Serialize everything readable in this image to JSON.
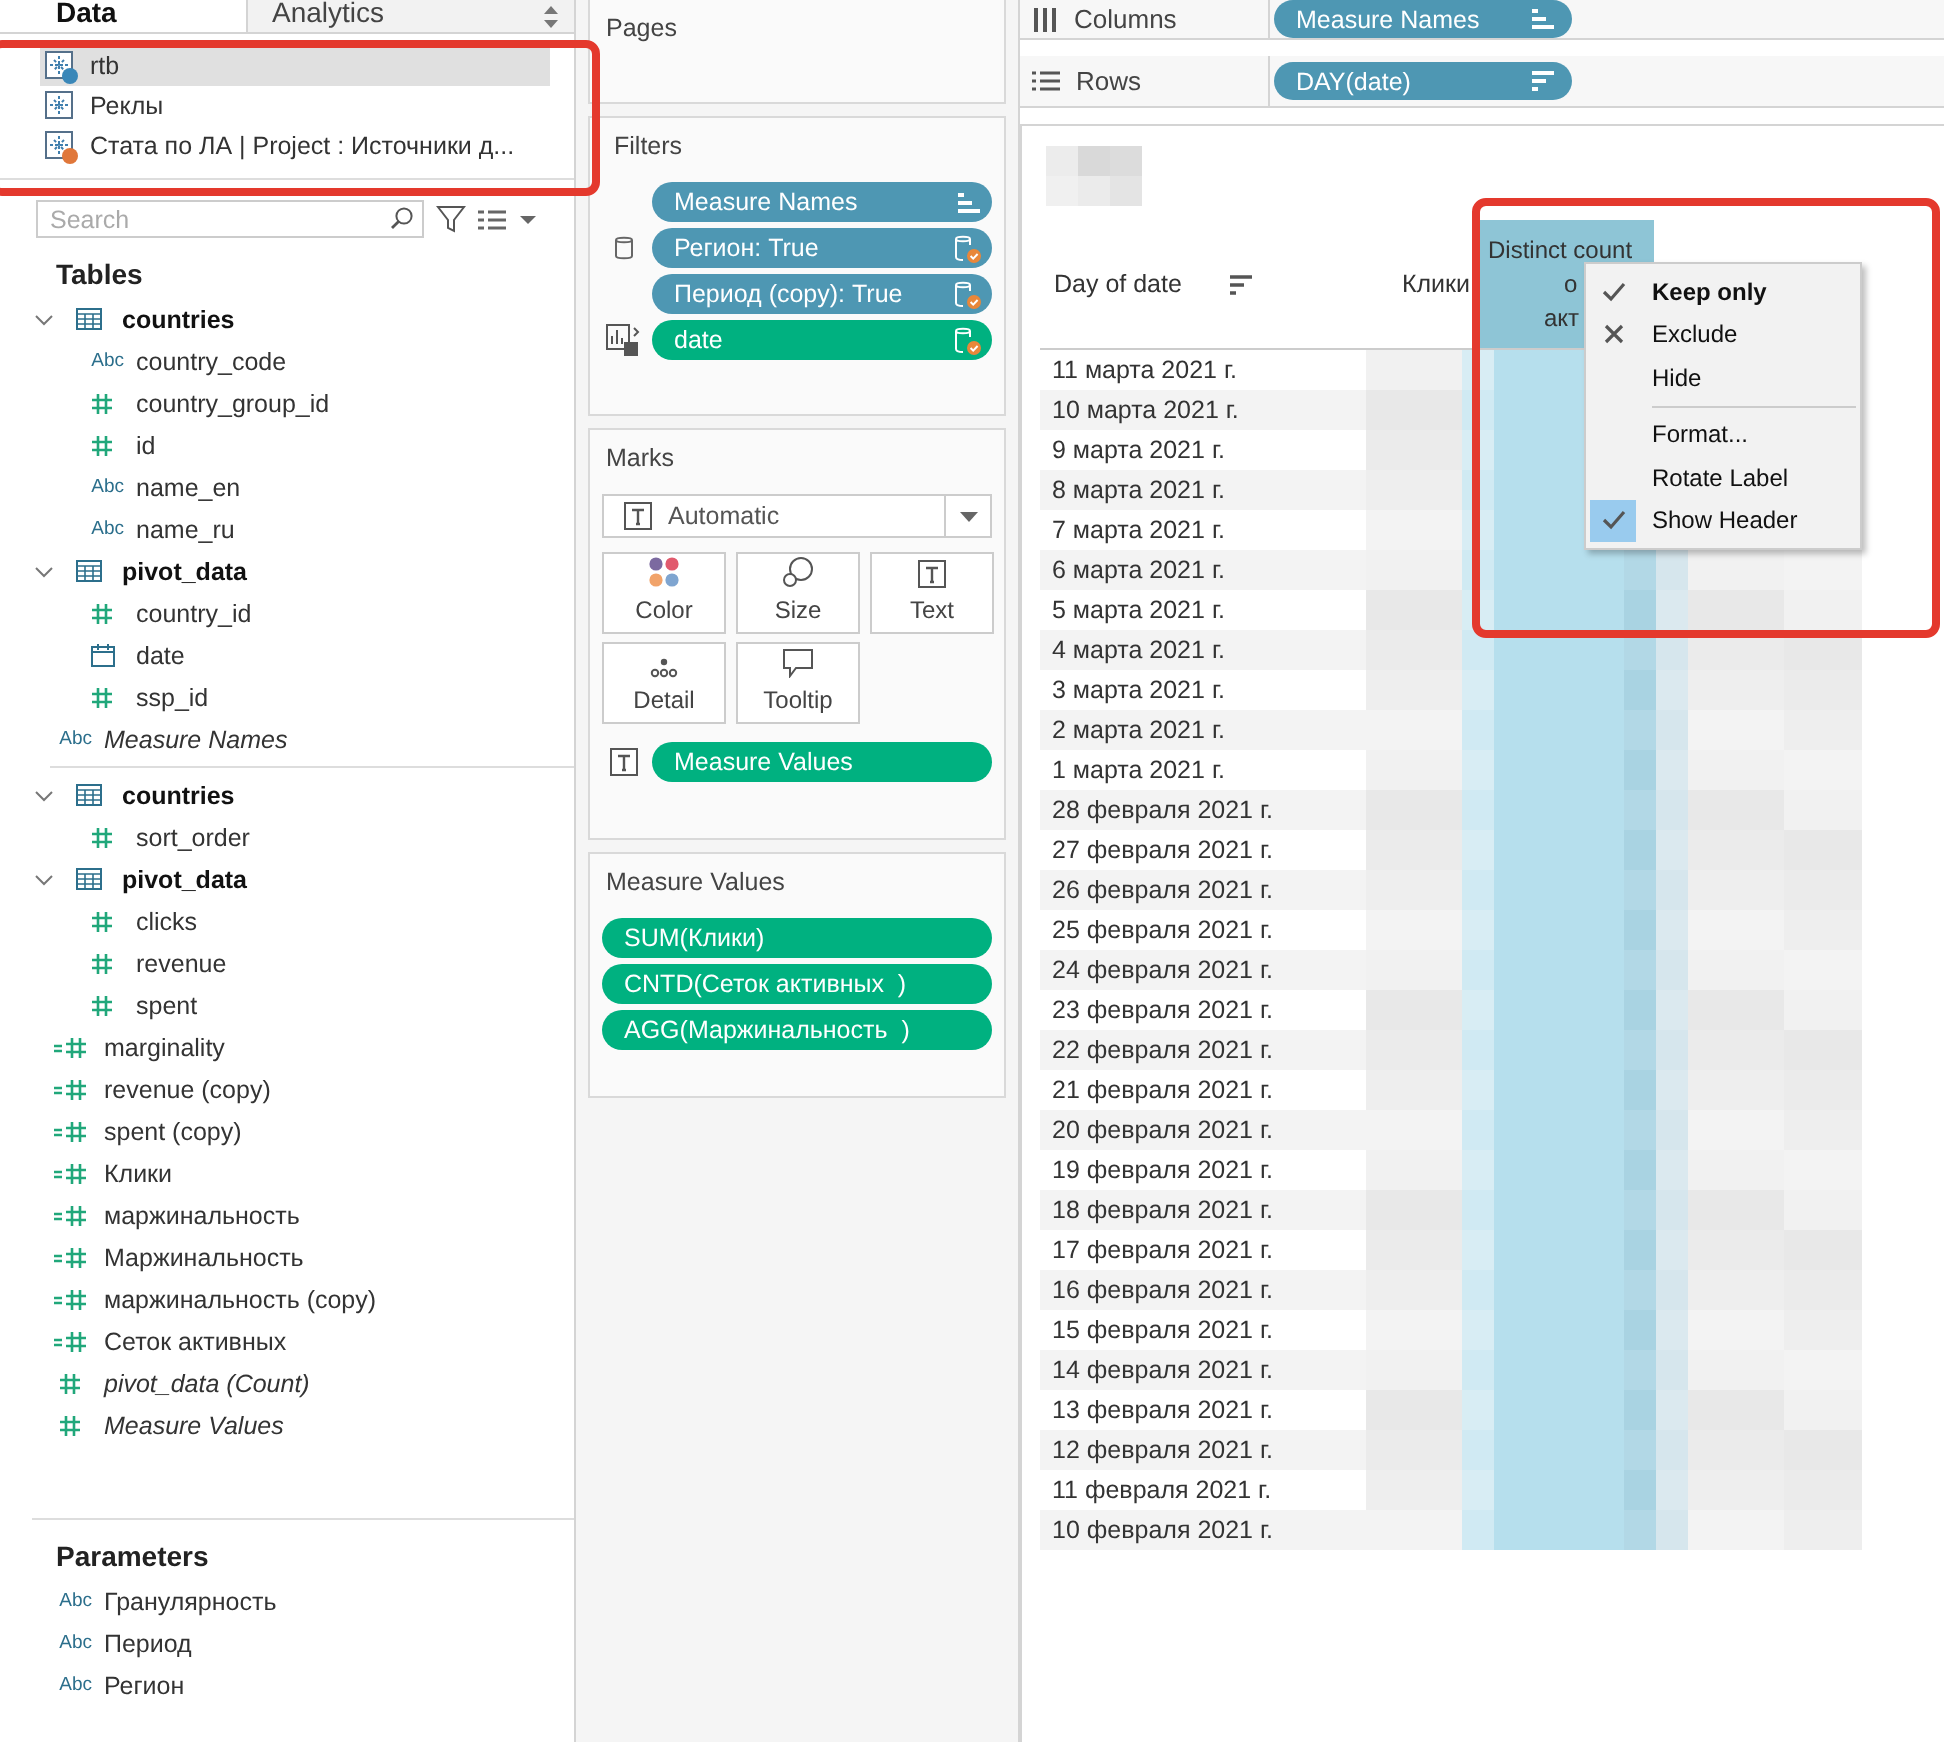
{
  "data_pane": {
    "tabs": [
      {
        "label": "Data",
        "selected": true
      },
      {
        "label": "Analytics",
        "selected": false
      }
    ],
    "data_sources": [
      {
        "name": "rtb",
        "selected": true,
        "color": "#3a87b8"
      },
      {
        "name": "Реклы",
        "selected": false
      },
      {
        "name": "Стата по ЛА | Project : Источники д...",
        "selected": false,
        "color": "#e0773a"
      }
    ],
    "search": {
      "placeholder": "Search"
    },
    "tables_heading": "Tables",
    "field_sections": [
      [
        {
          "kind": "table",
          "name": "countries",
          "expanded": true,
          "children": [
            {
              "name": "country_code",
              "kind": "string",
              "glyph": "Abc"
            },
            {
              "name": "country_group_id",
              "kind": "number"
            },
            {
              "name": "id",
              "kind": "number"
            },
            {
              "name": "name_en",
              "kind": "string",
              "glyph": "Abc"
            },
            {
              "name": "name_ru",
              "kind": "string",
              "glyph": "Abc"
            }
          ]
        },
        {
          "kind": "table",
          "name": "pivot_data",
          "expanded": true,
          "children": [
            {
              "name": "country_id",
              "kind": "number"
            },
            {
              "name": "date",
              "kind": "date"
            },
            {
              "name": "ssp_id",
              "kind": "number"
            }
          ]
        },
        {
          "kind": "string",
          "name": "Measure Names",
          "glyph": "Abc",
          "italic": true
        }
      ],
      [
        {
          "kind": "table",
          "name": "countries",
          "expanded": true,
          "children": [
            {
              "name": "sort_order",
              "kind": "number"
            }
          ]
        },
        {
          "kind": "table",
          "name": "pivot_data",
          "expanded": true,
          "children": [
            {
              "name": "clicks",
              "kind": "number"
            },
            {
              "name": "revenue",
              "kind": "number"
            },
            {
              "name": "spent",
              "kind": "number"
            }
          ]
        },
        {
          "kind": "calc",
          "name": "marginality",
          "italic": false
        },
        {
          "kind": "calc",
          "name": "revenue (copy)",
          "italic": false
        },
        {
          "kind": "calc",
          "name": "spent (copy)",
          "italic": false
        },
        {
          "kind": "calc",
          "name": "Клики",
          "italic": false
        },
        {
          "kind": "calc",
          "name": "маржинальность",
          "italic": false
        },
        {
          "kind": "calc",
          "name": "Маржинальность",
          "italic": false
        },
        {
          "kind": "calc",
          "name": "маржинальность (copy)",
          "italic": false
        },
        {
          "kind": "calc",
          "name": "Сеток активных",
          "italic": false
        },
        {
          "kind": "number",
          "name": "pivot_data (Count)",
          "italic": true
        },
        {
          "kind": "number",
          "name": "Measure Values",
          "italic": true
        }
      ]
    ],
    "parameters": {
      "heading": "Parameters",
      "items": [
        {
          "name": "Гранулярность",
          "glyph": "Abc"
        },
        {
          "name": "Период",
          "glyph": "Abc"
        },
        {
          "name": "Регион",
          "glyph": "Abc"
        }
      ]
    }
  },
  "cards": {
    "pages": {
      "title": "Pages"
    },
    "filters": {
      "title": "Filters",
      "pills": [
        {
          "label": "Measure Names",
          "kind": "discrete"
        },
        {
          "label": "Регион: True",
          "kind": "discrete"
        },
        {
          "label": "Период (copy): True",
          "kind": "discrete"
        },
        {
          "label": "date",
          "kind": "continuous"
        }
      ]
    },
    "marks": {
      "title": "Marks",
      "mark_type": "Automatic",
      "buttons": [
        {
          "label": "Color"
        },
        {
          "label": "Size"
        },
        {
          "label": "Text"
        },
        {
          "label": "Detail"
        },
        {
          "label": "Tooltip"
        }
      ],
      "pills": [
        {
          "label": "Measure Values",
          "kind": "continuous"
        }
      ]
    },
    "measure_values": {
      "title": "Measure Values",
      "pills": [
        {
          "label": "SUM(Клики)",
          "kind": "continuous"
        },
        {
          "label": "CNTD(Сеток активных  )",
          "kind": "continuous"
        },
        {
          "label": "AGG(Маржинальность  )",
          "kind": "continuous"
        }
      ]
    }
  },
  "shelves": [
    {
      "label": "Columns",
      "pill": {
        "label": "Measure Names",
        "kind": "discrete"
      }
    },
    {
      "label": "Rows",
      "pill": {
        "label": "DAY(date)",
        "kind": "discrete"
      }
    }
  ],
  "view": {
    "columns": [
      {
        "header": [
          "Day of date"
        ]
      },
      {
        "header": [
          "Клики"
        ]
      },
      {
        "header": [
          "Distinct count",
          "о",
          "акт"
        ],
        "highlighted": true
      }
    ],
    "rows": [
      "11 марта 2021 г.",
      "10 марта 2021 г.",
      "9 марта 2021 г.",
      "8 марта 2021 г.",
      "7 марта 2021 г.",
      "6 марта 2021 г.",
      "5 марта 2021 г.",
      "4 марта 2021 г.",
      "3 марта 2021 г.",
      "2 марта 2021 г.",
      "1 марта 2021 г.",
      "28 февраля 2021 г.",
      "27 февраля 2021 г.",
      "26 февраля 2021 г.",
      "25 февраля 2021 г.",
      "24 февраля 2021 г.",
      "23 февраля 2021 г.",
      "22 февраля 2021 г.",
      "21 февраля 2021 г.",
      "20 февраля 2021 г.",
      "19 февраля 2021 г.",
      "18 февраля 2021 г.",
      "17 февраля 2021 г.",
      "16 февраля 2021 г.",
      "15 февраля 2021 г.",
      "14 февраля 2021 г.",
      "13 февраля 2021 г.",
      "12 февраля 2021 г.",
      "11 февраля 2021 г.",
      "10 февраля 2021 г."
    ]
  },
  "context_menu": {
    "groups": [
      [
        {
          "label": "Keep only",
          "default": true,
          "checked": false
        },
        {
          "label": "Exclude",
          "default": false,
          "checked": false
        },
        {
          "label": "Hide",
          "default": false,
          "checked": false
        }
      ],
      [
        {
          "label": "Format...",
          "default": false,
          "checked": false
        },
        {
          "label": "Rotate Label",
          "default": false,
          "checked": false
        },
        {
          "label": "Show Header",
          "default": false,
          "checked": true
        }
      ]
    ]
  }
}
